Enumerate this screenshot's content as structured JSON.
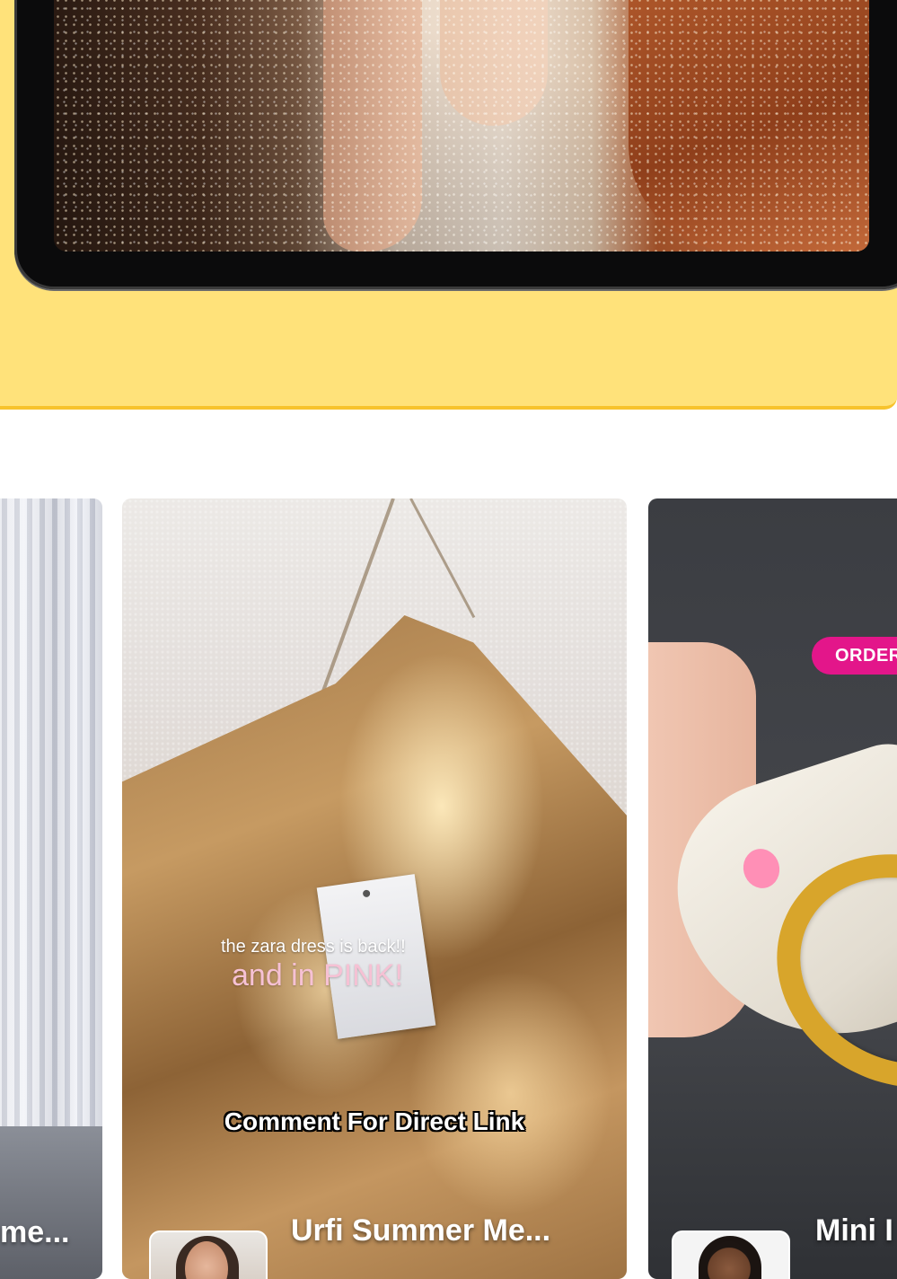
{
  "cards": [
    {
      "title": "me..."
    },
    {
      "title": "Urfi Summer Me...",
      "overlay_line1": "the zara dress is back!!",
      "overlay_line2": "and in PINK!",
      "overlay_comment": "Comment For Direct Link"
    },
    {
      "title": "Mini I",
      "badge": "ORDER"
    }
  ]
}
